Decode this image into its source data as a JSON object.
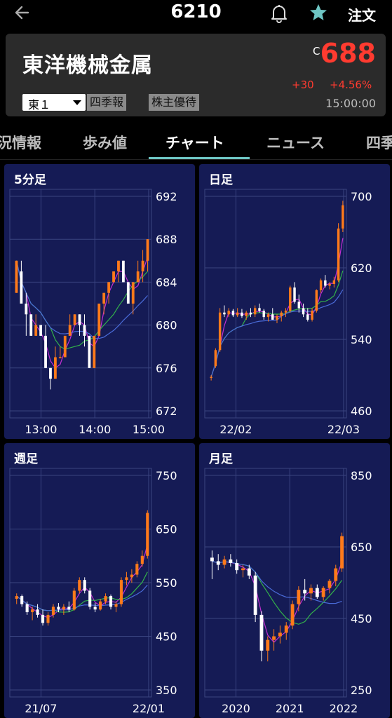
{
  "header": {
    "code": "6210",
    "order_label": "注文",
    "icons": [
      "back-arrow-icon",
      "bell-icon",
      "star-icon"
    ]
  },
  "stock": {
    "name": "東洋機械金属",
    "c_tag": "C",
    "price": "688",
    "change": "+30",
    "change_pct": "+4.56%",
    "time": "15:00:00",
    "market": "東１",
    "badges": [
      "四季報",
      "株主優待"
    ]
  },
  "tabs": [
    {
      "label": "況情報"
    },
    {
      "label": "歩み値"
    },
    {
      "label": "チャート",
      "active": true
    },
    {
      "label": "ニュース"
    },
    {
      "label": "四季"
    }
  ],
  "colors": {
    "up": "#ff7a1a",
    "down": "#ffffff",
    "ma_short": "#c22fd3",
    "ma_mid": "#33b24a",
    "ma_long": "#4a6bd8",
    "panel": "#151b55",
    "accent": "#6ec6c4",
    "price": "#ff3b30"
  },
  "chart_data": [
    {
      "type": "candlestick",
      "title": "5分足",
      "ylim": [
        672,
        692
      ],
      "yticks": [
        "692",
        "688",
        "684",
        "680",
        "676",
        "672"
      ],
      "xticks": [
        "13:00",
        "14:00",
        "15:00"
      ],
      "candles": [
        [
          683,
          686,
          683,
          686
        ],
        [
          685,
          686,
          682,
          682
        ],
        [
          682,
          683,
          679,
          681
        ],
        [
          681,
          681,
          679,
          679
        ],
        [
          679,
          681,
          679,
          680
        ],
        [
          680,
          680,
          679,
          679
        ],
        [
          679,
          680,
          676,
          676
        ],
        [
          676,
          676,
          674,
          675
        ],
        [
          675,
          678,
          675,
          677
        ],
        [
          677,
          678,
          677,
          677
        ],
        [
          677,
          679,
          677,
          679
        ],
        [
          679,
          681,
          679,
          680
        ],
        [
          680,
          681,
          680,
          681
        ],
        [
          681,
          681,
          679,
          680
        ],
        [
          680,
          681,
          678,
          679
        ],
        [
          679,
          679,
          676,
          676
        ],
        [
          676,
          679,
          676,
          679
        ],
        [
          679,
          682,
          679,
          682
        ],
        [
          682,
          683,
          681,
          683
        ],
        [
          683,
          684,
          682,
          684
        ],
        [
          684,
          685,
          684,
          685
        ],
        [
          685,
          686,
          684,
          686
        ],
        [
          686,
          686,
          684,
          684
        ],
        [
          684,
          684,
          682,
          682
        ],
        [
          682,
          684,
          681,
          684
        ],
        [
          684,
          686,
          684,
          685
        ],
        [
          685,
          687,
          684,
          686
        ],
        [
          686,
          688,
          685,
          688
        ]
      ]
    },
    {
      "type": "candlestick",
      "title": "日足",
      "ylim": [
        460,
        700
      ],
      "yticks": [
        "700",
        "620",
        "540",
        "460"
      ],
      "xticks": [
        "22/02",
        "22/03"
      ],
      "candles": [
        [
          497,
          500,
          494,
          498
        ],
        [
          510,
          530,
          508,
          528
        ],
        [
          528,
          575,
          526,
          570
        ],
        [
          570,
          578,
          565,
          568
        ],
        [
          568,
          575,
          565,
          572
        ],
        [
          572,
          574,
          565,
          567
        ],
        [
          567,
          575,
          565,
          570
        ],
        [
          570,
          574,
          564,
          566
        ],
        [
          566,
          572,
          562,
          570
        ],
        [
          570,
          575,
          565,
          568
        ],
        [
          568,
          578,
          565,
          575
        ],
        [
          575,
          580,
          570,
          572
        ],
        [
          572,
          574,
          562,
          565
        ],
        [
          565,
          570,
          560,
          568
        ],
        [
          568,
          575,
          562,
          562
        ],
        [
          562,
          568,
          558,
          566
        ],
        [
          566,
          572,
          560,
          570
        ],
        [
          570,
          575,
          565,
          572
        ],
        [
          572,
          600,
          570,
          598
        ],
        [
          598,
          604,
          580,
          582
        ],
        [
          582,
          590,
          570,
          575
        ],
        [
          575,
          580,
          565,
          568
        ],
        [
          568,
          575,
          560,
          562
        ],
        [
          562,
          575,
          560,
          572
        ],
        [
          572,
          596,
          570,
          595
        ],
        [
          595,
          608,
          592,
          606
        ],
        [
          606,
          612,
          598,
          600
        ],
        [
          600,
          604,
          596,
          602
        ],
        [
          602,
          610,
          598,
          606
        ],
        [
          606,
          670,
          604,
          664
        ],
        [
          664,
          695,
          660,
          690
        ]
      ]
    },
    {
      "type": "candlestick",
      "title": "週足",
      "ylim": [
        350,
        750
      ],
      "yticks": [
        "750",
        "650",
        "550",
        "450",
        "350"
      ],
      "xticks": [
        "21/07",
        "22/01"
      ],
      "candles": [
        [
          520,
          530,
          510,
          525
        ],
        [
          525,
          528,
          505,
          510
        ],
        [
          510,
          515,
          490,
          495
        ],
        [
          495,
          505,
          480,
          500
        ],
        [
          500,
          510,
          485,
          490
        ],
        [
          490,
          500,
          470,
          475
        ],
        [
          475,
          495,
          470,
          490
        ],
        [
          490,
          510,
          485,
          505
        ],
        [
          505,
          512,
          495,
          500
        ],
        [
          500,
          510,
          490,
          505
        ],
        [
          505,
          515,
          495,
          500
        ],
        [
          500,
          540,
          498,
          535
        ],
        [
          535,
          560,
          530,
          555
        ],
        [
          555,
          560,
          530,
          535
        ],
        [
          535,
          540,
          500,
          505
        ],
        [
          505,
          512,
          495,
          500
        ],
        [
          500,
          520,
          498,
          515
        ],
        [
          515,
          530,
          510,
          525
        ],
        [
          525,
          528,
          500,
          505
        ],
        [
          505,
          515,
          495,
          510
        ],
        [
          510,
          560,
          505,
          555
        ],
        [
          555,
          570,
          545,
          560
        ],
        [
          560,
          575,
          550,
          565
        ],
        [
          565,
          590,
          560,
          585
        ],
        [
          585,
          610,
          580,
          600
        ],
        [
          600,
          685,
          595,
          680
        ]
      ]
    },
    {
      "type": "candlestick",
      "title": "月足",
      "ylim": [
        250,
        850
      ],
      "yticks": [
        "850",
        "650",
        "450",
        "250"
      ],
      "xticks": [
        "2020",
        "2021",
        "2022"
      ],
      "candles": [
        [
          620,
          640,
          560,
          610
        ],
        [
          610,
          630,
          585,
          600
        ],
        [
          600,
          625,
          590,
          615
        ],
        [
          615,
          630,
          595,
          605
        ],
        [
          605,
          615,
          575,
          585
        ],
        [
          585,
          600,
          565,
          590
        ],
        [
          590,
          600,
          560,
          570
        ],
        [
          570,
          580,
          440,
          460
        ],
        [
          460,
          470,
          330,
          360
        ],
        [
          360,
          400,
          330,
          390
        ],
        [
          390,
          420,
          360,
          400
        ],
        [
          400,
          430,
          380,
          410
        ],
        [
          410,
          440,
          390,
          430
        ],
        [
          430,
          500,
          420,
          490
        ],
        [
          490,
          540,
          470,
          530
        ],
        [
          530,
          560,
          500,
          520
        ],
        [
          520,
          545,
          500,
          535
        ],
        [
          535,
          545,
          505,
          510
        ],
        [
          510,
          540,
          500,
          535
        ],
        [
          535,
          560,
          520,
          555
        ],
        [
          555,
          600,
          540,
          590
        ],
        [
          590,
          690,
          580,
          680
        ]
      ]
    }
  ]
}
